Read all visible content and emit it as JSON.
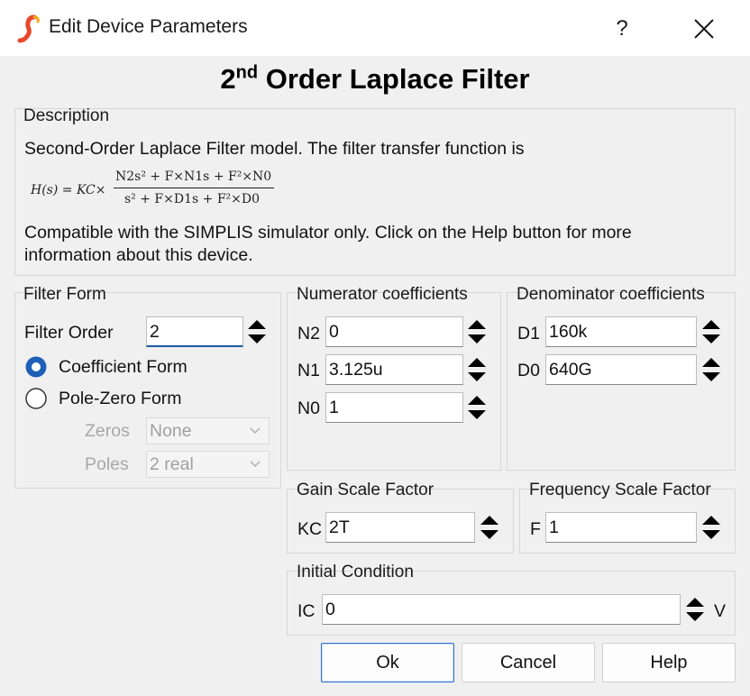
{
  "window": {
    "title": "Edit Device Parameters",
    "help_glyph": "?",
    "heading_main": "2",
    "heading_sup": "nd",
    "heading_rest": " Order Laplace Filter"
  },
  "description": {
    "label": "Description",
    "line1": "Second-Order Laplace Filter model. The filter transfer function is",
    "formula_lhs": "H(s) = KC×",
    "formula_num": "N2s² + F×N1s + F²×N0",
    "formula_den": "s² + F×D1s + F²×D0",
    "line2": "Compatible with the SIMPLIS simulator only. Click on the Help button for more",
    "line3": "information about this device."
  },
  "filter_form": {
    "label": "Filter Form",
    "order_label": "Filter Order",
    "order_value": "2",
    "coefficient_label": "Coefficient Form",
    "polezero_label": "Pole-Zero Form",
    "zeros_label": "Zeros",
    "zeros_value": "None",
    "poles_label": "Poles",
    "poles_value": "2 real"
  },
  "numerator": {
    "label": "Numerator coefficients",
    "n2_label": "N2",
    "n2_value": "0",
    "n1_label": "N1",
    "n1_value": "3.125u",
    "n0_label": "N0",
    "n0_value": "1"
  },
  "denominator": {
    "label": "Denominator coefficients",
    "d1_label": "D1",
    "d1_value": "160k",
    "d0_label": "D0",
    "d0_value": "640G"
  },
  "gain": {
    "label": "Gain Scale Factor",
    "kc_label": "KC",
    "kc_value": "2T"
  },
  "frequency": {
    "label": "Frequency Scale Factor",
    "f_label": "F",
    "f_value": "1"
  },
  "initial": {
    "label": "Initial Condition",
    "ic_label": "IC",
    "ic_value": "0",
    "unit": "V"
  },
  "buttons": {
    "ok": "Ok",
    "cancel": "Cancel",
    "help": "Help"
  },
  "colors": {
    "accent": "#1e5aa8",
    "radio_selected": "#1f5fb8",
    "app_icon": "#e8492b"
  }
}
